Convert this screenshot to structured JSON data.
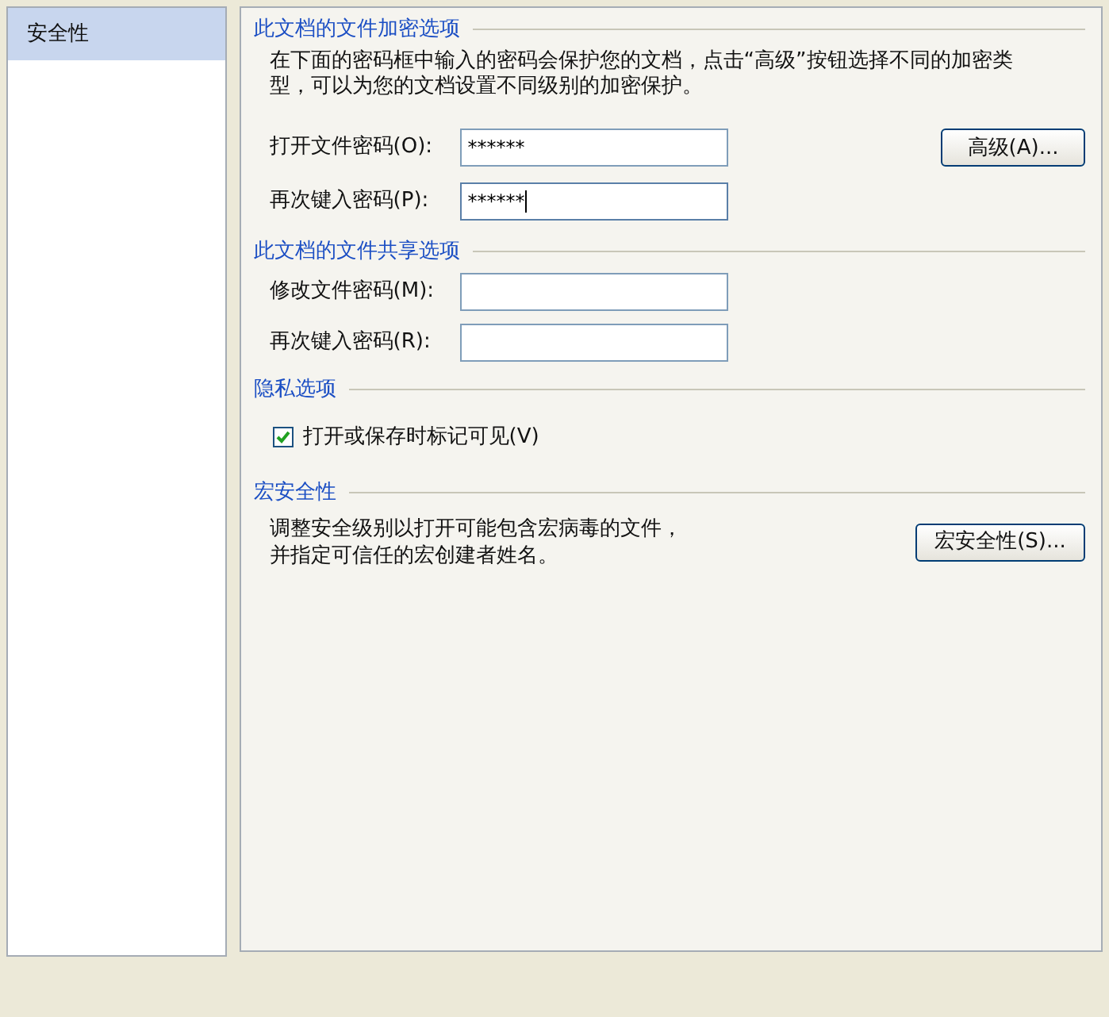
{
  "sidebar": {
    "items": [
      {
        "label": "安全性",
        "selected": true
      }
    ]
  },
  "encryption": {
    "title": "此文档的文件加密选项",
    "description": "在下面的密码框中输入的密码会保护您的文档，点击“高级”按钮选择不同的加密类型，可以为您的文档设置不同级别的加密保护。",
    "fields": [
      {
        "label": "打开文件密码(O):",
        "value": "******",
        "focused": false
      },
      {
        "label": "再次键入密码(P):",
        "value": "******",
        "focused": true
      }
    ],
    "button": "高级(A)..."
  },
  "sharing": {
    "title": "此文档的文件共享选项",
    "fields": [
      {
        "label": "修改文件密码(M):",
        "focused": false
      },
      {
        "label": "再次键入密码(R):",
        "focused": false
      }
    ]
  },
  "privacy": {
    "title": "隐私选项",
    "checkbox": {
      "label": "打开或保存时标记可见(V)",
      "checked": true
    }
  },
  "macro": {
    "title": "宏安全性",
    "description": "调整安全级别以打开可能包含宏病毒的文件，并指定可信任的宏创建者姓名。",
    "button": "宏安全性(S)..."
  }
}
